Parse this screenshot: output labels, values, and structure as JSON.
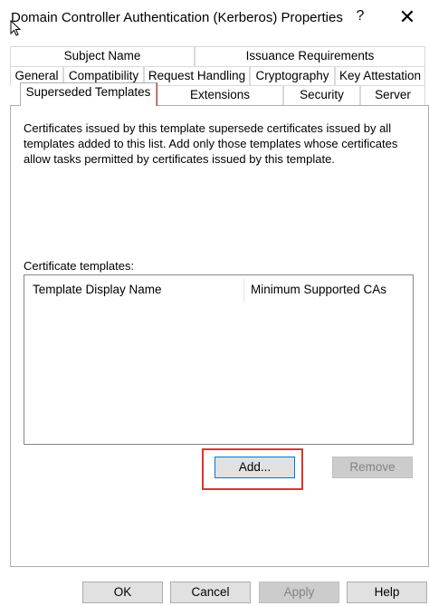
{
  "window": {
    "title": "Domain Controller Authentication (Kerberos) Properties",
    "help_label": "?",
    "close_label": "✕"
  },
  "tabs": {
    "row1": [
      "Subject Name",
      "Issuance Requirements"
    ],
    "row2": [
      "General",
      "Compatibility",
      "Request Handling",
      "Cryptography",
      "Key Attestation"
    ],
    "row3": [
      "Superseded Templates",
      "Extensions",
      "Security",
      "Server"
    ],
    "selected": "Superseded Templates"
  },
  "content": {
    "description": "Certificates issued by this template supersede certificates issued by all templates added to this list. Add only those templates whose certificates allow tasks permitted by certificates issued by this template.",
    "list_label": "Certificate templates:",
    "columns": [
      "Template Display Name",
      "Minimum Supported CAs"
    ],
    "add_label": "Add...",
    "remove_label": "Remove"
  },
  "footer": {
    "ok_label": "OK",
    "cancel_label": "Cancel",
    "apply_label": "Apply",
    "help_label": "Help"
  },
  "colors": {
    "highlight": "#e0322f",
    "focus": "#0078d7"
  }
}
